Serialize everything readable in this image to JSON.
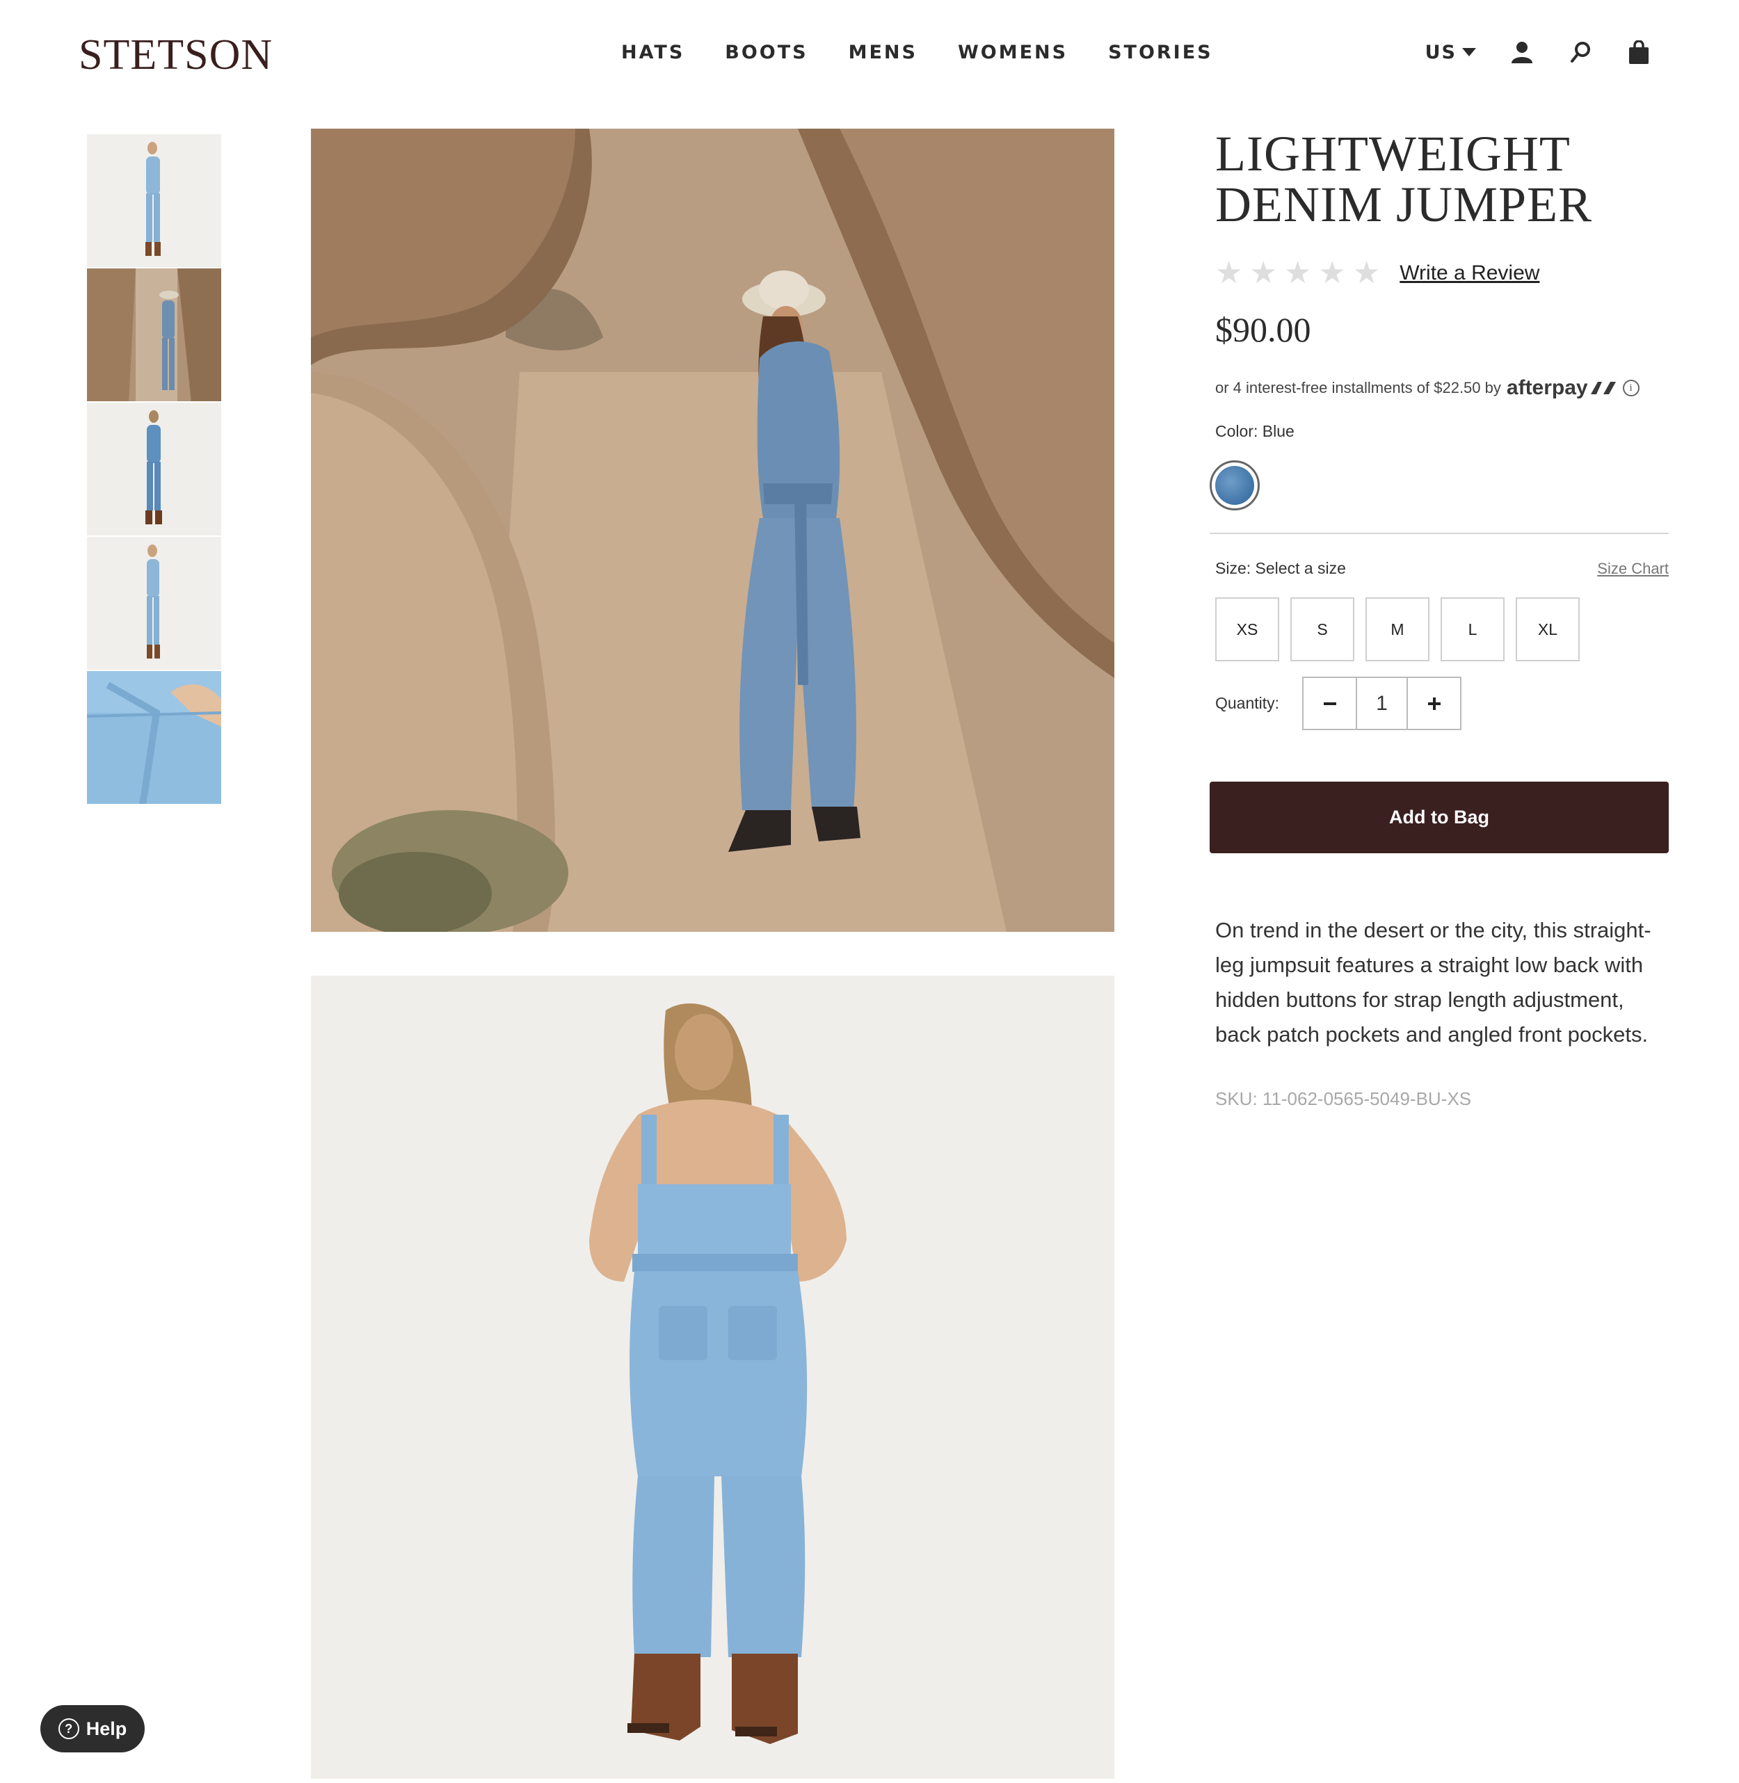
{
  "header": {
    "logo": "STETSON",
    "nav": [
      "HATS",
      "BOOTS",
      "MENS",
      "WOMENS",
      "STORIES"
    ],
    "locale": "US",
    "icons": [
      "account-icon",
      "search-icon",
      "bag-icon"
    ]
  },
  "gallery": {
    "thumbnail_count": 5
  },
  "product": {
    "title": "LIGHTWEIGHT DENIM JUMPER",
    "rating": 0,
    "review_link": "Write a Review",
    "price": "$90.00",
    "afterpay_text": "or 4 interest-free installments of $22.50 by",
    "afterpay_brand": "afterpay",
    "color_label": "Color:",
    "color_value": "Blue",
    "swatch_color": "#4a7fb0",
    "size_label": "Size:",
    "size_value": "Select a size",
    "size_chart": "Size Chart",
    "sizes": [
      "XS",
      "S",
      "M",
      "L",
      "XL"
    ],
    "quantity_label": "Quantity:",
    "quantity": "1",
    "add_to_bag": "Add to Bag",
    "description": "On trend in the desert or the city, this straight-leg jumpsuit features a straight low back with hidden buttons for strap length adjustment, back patch pockets and angled front pockets.",
    "sku": "SKU: 11-062-0565-5049-BU-XS"
  },
  "help": {
    "label": "Help"
  },
  "colors": {
    "brand": "#3b2020",
    "text": "#2b2b2b"
  }
}
